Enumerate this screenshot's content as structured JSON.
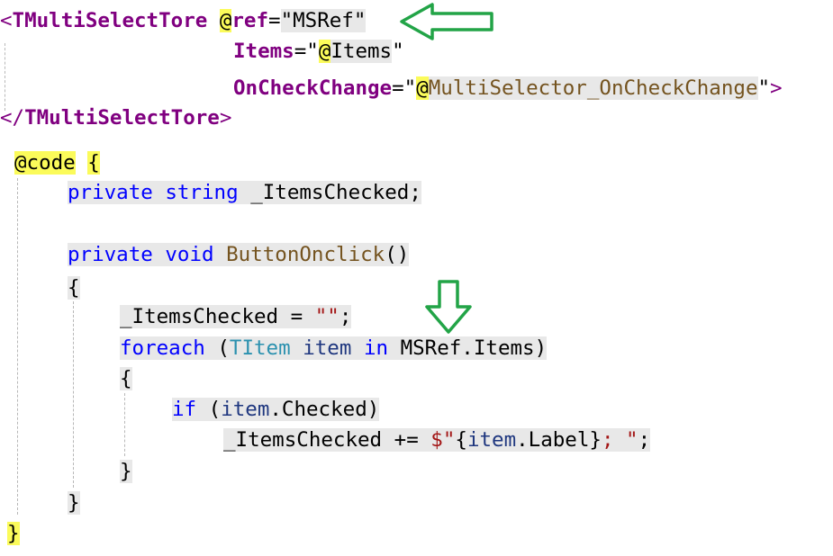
{
  "code": {
    "component_tag": "TMultiSelectTore",
    "open_bracket": "<",
    "close_tag_open": "</",
    "tag_close": ">",
    "at_sign": "@",
    "ref_attr": "ref",
    "equals": "=",
    "quote": "\"",
    "ref_value": "MSRef",
    "items_attr": "Items",
    "items_value": "Items",
    "oncheck_attr": "OnCheckChange",
    "oncheck_value": "MultiSelector_OnCheckChange",
    "code_directive": "code",
    "brace_open": "{",
    "brace_close": "}",
    "kw_private": "private",
    "kw_string": "string",
    "field_name": "_ItemsChecked",
    "semicolon": ";",
    "kw_void": "void",
    "method_name": "ButtonOnclick",
    "parens": "()",
    "assign_op": " = ",
    "empty_string": "\"\"",
    "kw_foreach": "foreach",
    "paren_open": "(",
    "paren_close": ")",
    "type_titem": "TItem",
    "var_item": "item",
    "kw_in": "in",
    "ms_ref_items": "MSRef.Items",
    "kw_if": "if",
    "item_checked": ".Checked",
    "plus_assign": " += ",
    "interp_prefix": "$\"",
    "interp_expr_label": ".Label",
    "interp_tail": "; ",
    "closing_quote": "\""
  },
  "annotations": {
    "arrow_color": "#22a447",
    "arrow_left_icon": "arrow-left-icon",
    "arrow_down_icon": "arrow-down-icon"
  }
}
